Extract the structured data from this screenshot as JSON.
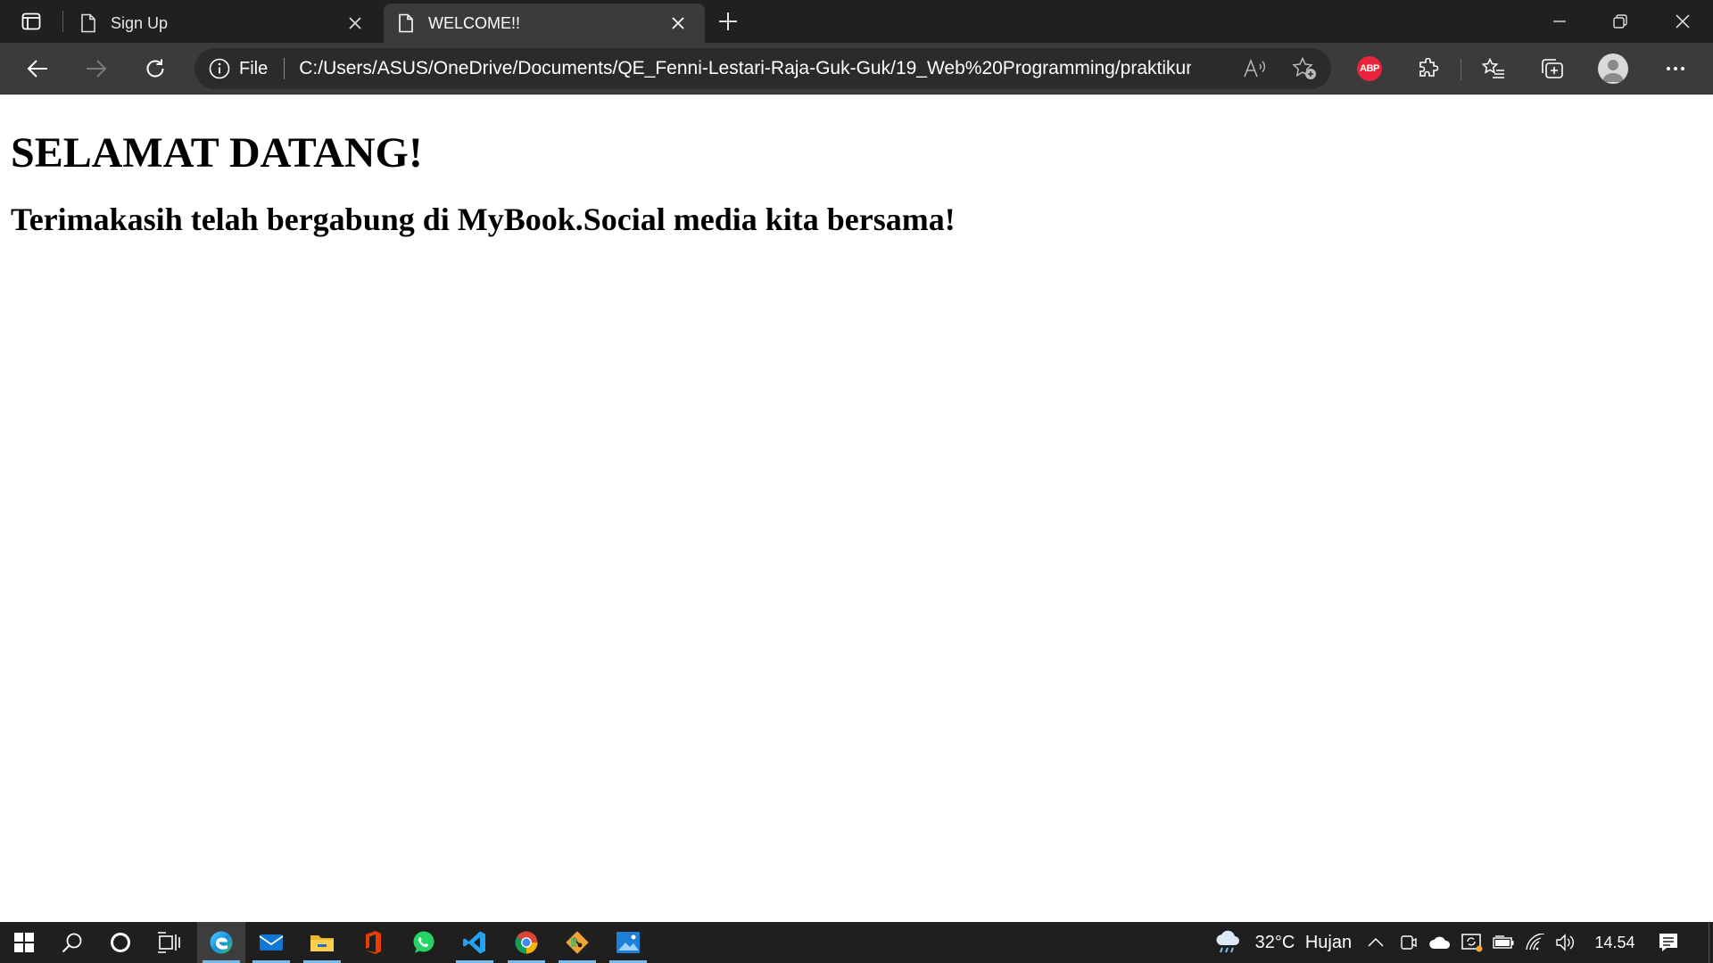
{
  "browser": {
    "tabs": [
      {
        "title": "Sign Up",
        "active": false
      },
      {
        "title": "WELCOME!!",
        "active": true
      }
    ],
    "address": {
      "scheme_label": "File",
      "url": "C:/Users/ASUS/OneDrive/Documents/QE_Fenni-Lestari-Raja-Guk-Guk/19_Web%20Programming/praktikum/..."
    },
    "extensions": {
      "adblock_label": "ABP"
    }
  },
  "page": {
    "heading": "SELAMAT DATANG!",
    "subheading": "Terimakasih telah bergabung di MyBook.Social media kita bersama!"
  },
  "taskbar": {
    "weather": {
      "temperature": "32°C",
      "condition": "Hujan"
    },
    "clock": "14.54"
  },
  "colors": {
    "tab_strip": "#202020",
    "toolbar": "#3b3b3b",
    "taskbar": "#1f1f1f",
    "taskbar_indicator": "#76b9ed",
    "abp_badge": "#e8233b"
  }
}
